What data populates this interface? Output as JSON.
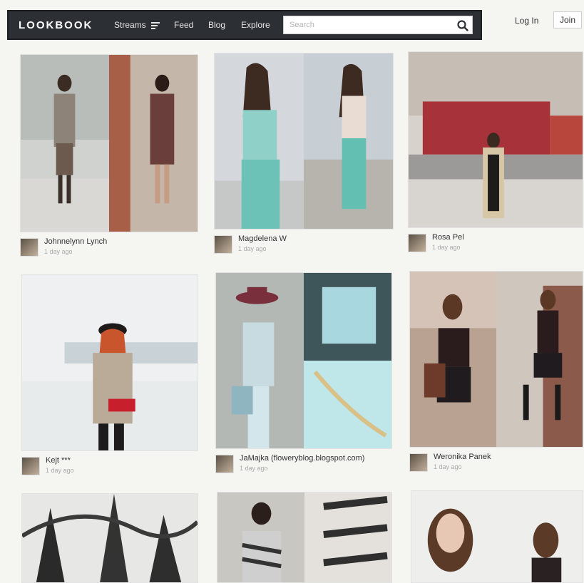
{
  "brand": {
    "logo": "LOOKBOOK"
  },
  "nav": {
    "streams": "Streams",
    "feed": "Feed",
    "blog": "Blog",
    "explore": "Explore",
    "search_placeholder": "Search"
  },
  "account": {
    "login": "Log In",
    "join": "Join"
  },
  "colors": {
    "nav_bg": "#2c2f33",
    "page_bg": "#f5f5f2",
    "accent": "#ffffff"
  },
  "icons": {
    "search": "search-icon",
    "streams": "hamburger-icon"
  },
  "cards": [
    {
      "author": "Johnnelynn Lynch",
      "time": "1 day ago"
    },
    {
      "author": "Magdelena W",
      "time": "1 day ago"
    },
    {
      "author": "Rosa Pel",
      "time": "1 day ago"
    },
    {
      "author": "Kejt ***",
      "time": "1 day ago"
    },
    {
      "author": "JaMajka (floweryblog.blogspot.com)",
      "time": "1 day ago"
    },
    {
      "author": "Weronika Panek",
      "time": "1 day ago"
    },
    {
      "author": "",
      "time": ""
    },
    {
      "author": "",
      "time": ""
    },
    {
      "author": "",
      "time": ""
    }
  ]
}
